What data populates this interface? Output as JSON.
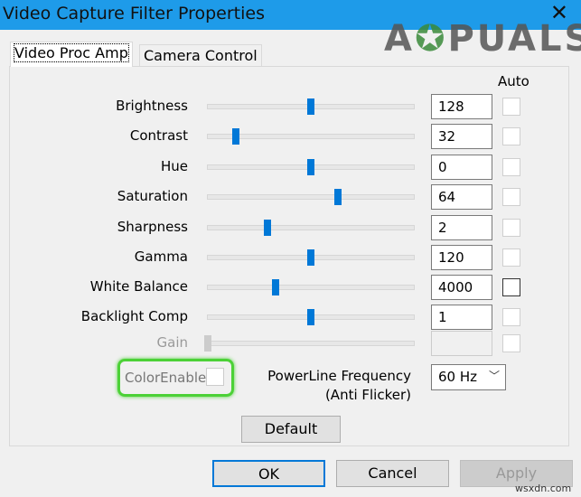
{
  "window": {
    "title": "Video Capture Filter Properties",
    "close": "✕",
    "watermark": "APPUALS",
    "footer_watermark": "wsxdn.com"
  },
  "tabs": [
    {
      "label": "Video Proc Amp",
      "active": true
    },
    {
      "label": "Camera Control",
      "active": false
    }
  ],
  "auto_header": "Auto",
  "properties": [
    {
      "label": "Brightness",
      "value": "128",
      "slider": 0.5,
      "auto": false
    },
    {
      "label": "Contrast",
      "value": "32",
      "slider": 0.135,
      "auto": false
    },
    {
      "label": "Hue",
      "value": "0",
      "slider": 0.5,
      "auto": false
    },
    {
      "label": "Saturation",
      "value": "64",
      "slider": 0.63,
      "auto": false
    },
    {
      "label": "Sharpness",
      "value": "2",
      "slider": 0.29,
      "auto": false
    },
    {
      "label": "Gamma",
      "value": "120",
      "slider": 0.5,
      "auto": false
    },
    {
      "label": "White Balance",
      "value": "4000",
      "slider": 0.33,
      "auto": false
    },
    {
      "label": "Backlight Comp",
      "value": "1",
      "slider": 0.5,
      "auto": false
    },
    {
      "label": "Gain",
      "value": "",
      "slider": 0,
      "auto": false,
      "disabled": true
    }
  ],
  "color_enable": {
    "label": "ColorEnable",
    "checked": false,
    "highlight_color": "#4cd137"
  },
  "powerline": {
    "label": "PowerLine Frequency",
    "sublabel": "(Anti Flicker)",
    "value": "60 Hz"
  },
  "buttons": {
    "default": "Default",
    "ok": "OK",
    "cancel": "Cancel",
    "apply": "Apply"
  },
  "colors": {
    "titlebar": "#1e9be9",
    "accent": "#0078d7"
  }
}
